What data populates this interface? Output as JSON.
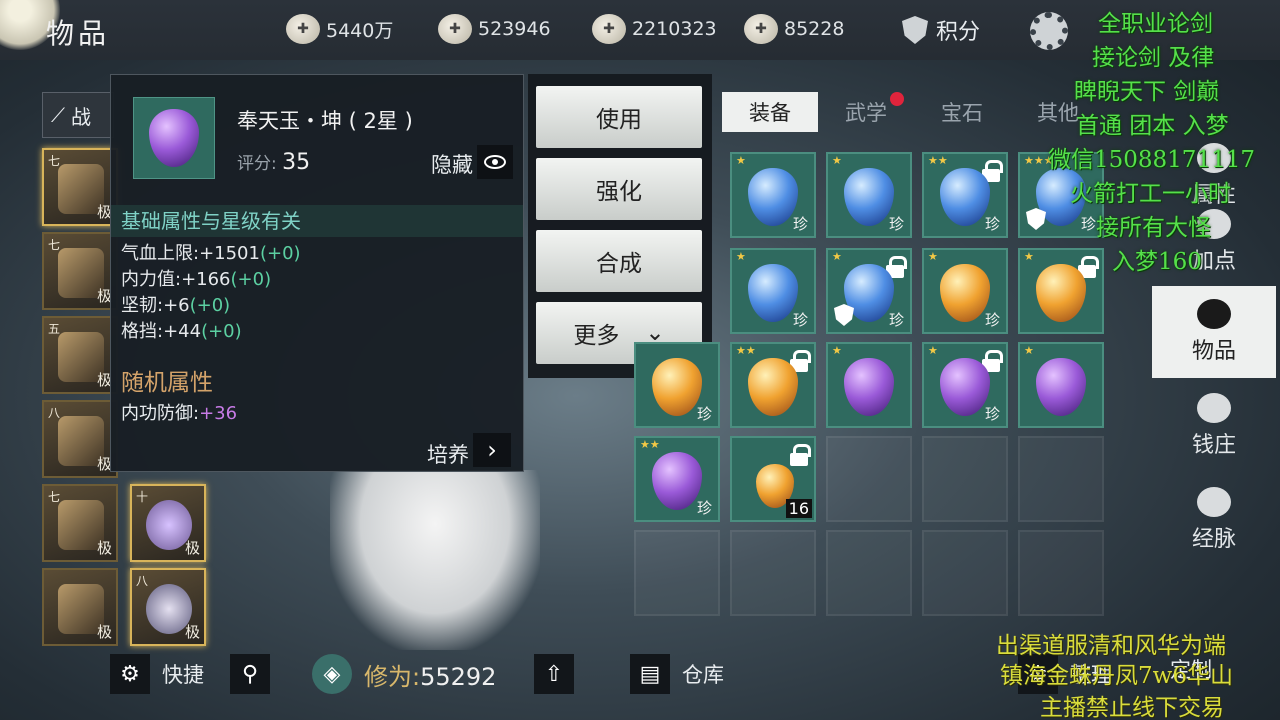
{
  "header": {
    "title": "物品",
    "currencies": [
      {
        "icon": "coin-icon",
        "value": "5440万"
      },
      {
        "icon": "ingot-icon",
        "value": "523946"
      },
      {
        "icon": "jade-icon",
        "value": "2210323"
      },
      {
        "icon": "gold-ingot-icon",
        "value": "85228"
      }
    ],
    "points_label": "积分"
  },
  "left_tab": {
    "label": "战"
  },
  "equipment_slots": [
    {
      "level": "七",
      "quality": "极"
    },
    {
      "level": "七",
      "quality": "极"
    },
    {
      "level": "五",
      "quality": "极"
    },
    {
      "level": "八",
      "quality": "极"
    },
    {
      "level": "七",
      "quality": "极"
    },
    {
      "level": "十",
      "quality": "极"
    },
    {
      "level": "",
      "quality": "极"
    },
    {
      "level": "八",
      "quality": "极"
    }
  ],
  "tooltip": {
    "name": "奉天玉・坤 ( 2星 )",
    "score_label": "评分:",
    "score": "35",
    "hide_label": "隐藏",
    "base_header": "基础属性与星级有关",
    "attrs": [
      {
        "label": "气血上限:+1501",
        "bonus": "(+0)"
      },
      {
        "label": "内力值:+166",
        "bonus": "(+0)"
      },
      {
        "label": "坚韧:+6",
        "bonus": "(+0)"
      },
      {
        "label": "格挡:+44",
        "bonus": "(+0)"
      }
    ],
    "random_header": "随机属性",
    "random_attr_label": "内功防御:",
    "random_attr_value": "+36",
    "foster_label": "培养"
  },
  "menu": {
    "use": "使用",
    "enhance": "强化",
    "combine": "合成",
    "more": "更多"
  },
  "inventory": {
    "tabs": [
      "装备",
      "武学",
      "宝石",
      "其他"
    ],
    "zhen": "珍",
    "stack_count": "16"
  },
  "right_nav": {
    "attr": "属性",
    "addpoint": "加点",
    "items": "物品",
    "bank": "钱庄",
    "meridian": "经脉"
  },
  "bottom": {
    "shortcut": "快捷",
    "xiuwei_label": "修为:",
    "xiuwei_value": "55292",
    "warehouse": "仓库",
    "sort": "整理",
    "custom": "定制"
  },
  "overlay": {
    "lines": [
      "全职业论剑",
      "接论剑 及律",
      "睥睨天下  剑巅",
      "首通 团本 入梦",
      "微信15088171117",
      "火箭打工一小时",
      "接所有大怪",
      "入梦160"
    ],
    "bottom_lines": [
      "出渠道服清和风华为端",
      "镇海金蛛丹凤7w6华山",
      "主播禁止线下交易"
    ]
  }
}
